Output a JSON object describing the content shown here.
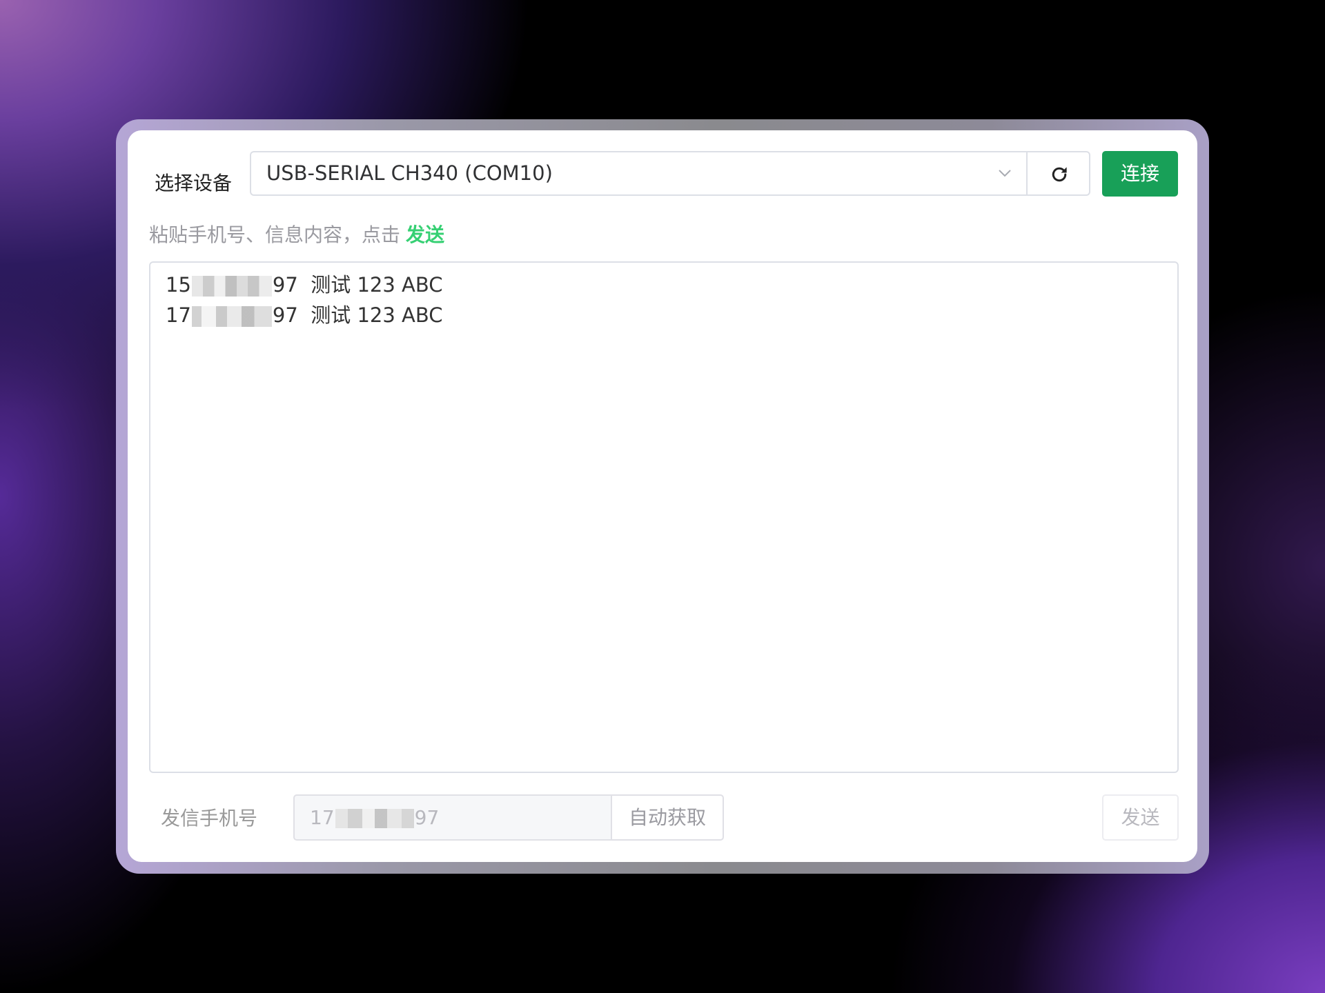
{
  "device": {
    "label": "选择设备",
    "selected": "USB-SERIAL CH340 (COM10)",
    "refresh_icon": "refresh-icon",
    "dropdown_icon": "chevron-down-icon",
    "connect_label": "连接"
  },
  "hint": {
    "text": "粘贴手机号、信息内容，点击",
    "action": "发送"
  },
  "messages": [
    {
      "prefix": "15",
      "suffix": "97",
      "content": "测试 123 ABC"
    },
    {
      "prefix": "17",
      "suffix": "97",
      "content": "测试 123 ABC"
    }
  ],
  "sender": {
    "label": "发信手机号",
    "prefix": "17",
    "suffix": "97",
    "auto_label": "自动获取",
    "send_label": "发送"
  },
  "colors": {
    "primary": "#18a058",
    "accent_text": "#36d073"
  }
}
